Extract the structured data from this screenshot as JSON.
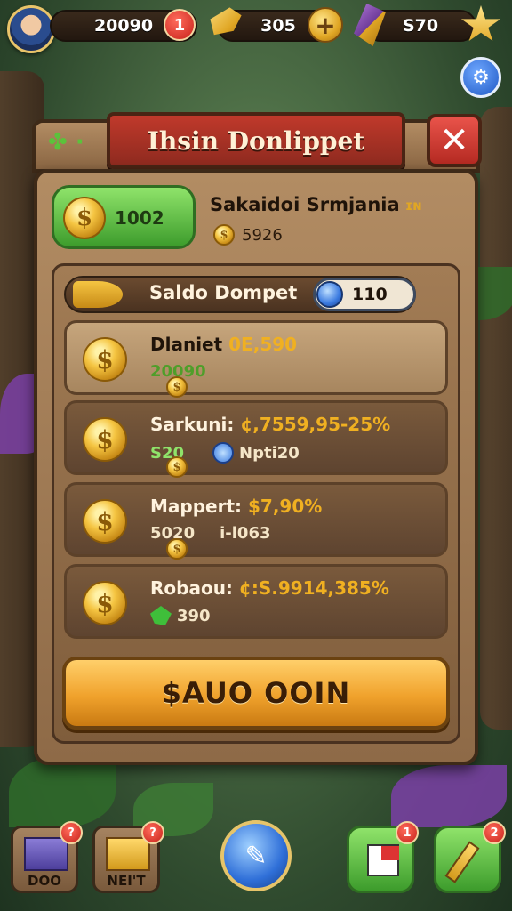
{
  "top_bar": {
    "currency1_value": "20090",
    "currency1_badge": "1",
    "currency2_value": "305",
    "currency2_add_symbol": "+",
    "currency3_value": "S70"
  },
  "dialog": {
    "title": "Ihsin Donlippet",
    "close_symbol": "✕",
    "wallet_amount": "1002",
    "user_name": "Sakaidoi Srmjania",
    "user_name_suffix": "ɪɴ",
    "user_coins": "5926",
    "saldo_label": "Saldo Dompet",
    "saldo_value": "110",
    "rows": [
      {
        "label": "Dlaniet",
        "value": "0E,590",
        "sub1": "20090",
        "sub2": ""
      },
      {
        "label": "Sarkuni:",
        "value": "¢,7559,95-25%",
        "sub1": "S20",
        "sub2": "Npti20"
      },
      {
        "label": "Mappert:",
        "value": "$7,90%",
        "sub1": "5020",
        "sub2": "i-l063"
      },
      {
        "label": "Robaou:",
        "value": "¢:S.9914,385%",
        "sub1": "390",
        "sub2": ""
      }
    ],
    "action_button": "$AUO OOIN"
  },
  "bottom_bar": {
    "btn1_label": "DOO",
    "btn1_badge": "?",
    "btn2_label": "NEI'T",
    "btn2_badge": "?",
    "btn4_badge": "1",
    "btn5_badge": "2"
  },
  "colors": {
    "title_banner": "#c0392b",
    "action_button": "#f0a22c",
    "wallet_green": "#3d9c2c",
    "gold_text": "#f0b021"
  },
  "icons": [
    "avatar",
    "gold-feather-icon",
    "plus-coin-icon",
    "purple-gem-icon",
    "star-icon",
    "settings-icon",
    "clover-icon",
    "key-icon",
    "blue-gem-icon",
    "coin-icon",
    "crate-icon",
    "pen-icon",
    "flag-icon",
    "pencil-icon"
  ]
}
